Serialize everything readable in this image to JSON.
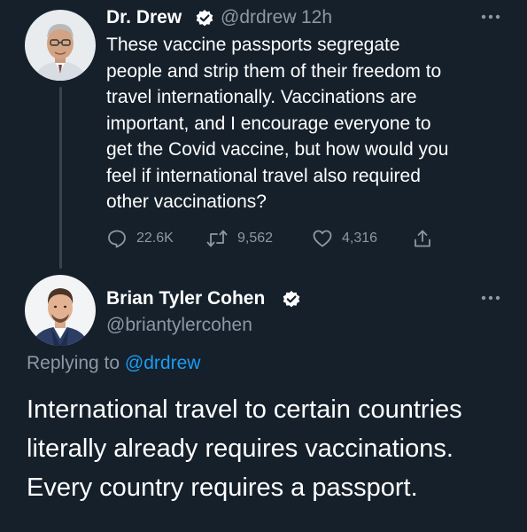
{
  "original_tweet": {
    "author_name": "Dr. Drew",
    "handle": "@drdrew",
    "separator": "·",
    "time": "12h",
    "text": "These vaccine passports segregate\npeople and strip them of their freedom to\ntravel internationally. Vaccinations are\nimportant, and I encourage everyone to\nget the Covid vaccine, but how would you\nfeel if international travel also required\nother vaccinations?",
    "replies": "22.6K",
    "retweets": "9,562",
    "likes": "4,316"
  },
  "reply_tweet": {
    "author_name": "Brian Tyler Cohen",
    "handle": "@briantylercohen",
    "replying_prefix": "Replying to",
    "replying_to": "@drdrew",
    "text": "International travel to certain countries\nliterally already requires vaccinations.\nEvery country requires a passport."
  },
  "icons": {
    "verified": "verified-badge-icon",
    "more": "more-options-icon",
    "reply": "reply-icon",
    "retweet": "retweet-icon",
    "like": "like-icon",
    "share": "share-icon"
  },
  "colors": {
    "background": "#15202b",
    "primary_text": "#ffffff",
    "secondary_text": "#8b98a5",
    "link": "#1d9bf0",
    "thread_line": "#38444d"
  }
}
